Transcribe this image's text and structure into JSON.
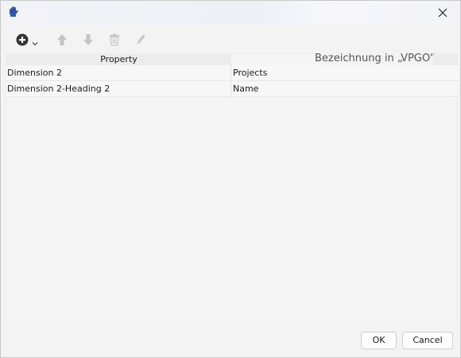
{
  "window": {
    "app_icon": "hand-icon",
    "close_icon": "close-icon"
  },
  "toolbar": {
    "buttons": [
      {
        "name": "add",
        "icon": "plus-circle-icon",
        "enabled": true
      },
      {
        "name": "move-up",
        "icon": "arrow-up-icon",
        "enabled": false
      },
      {
        "name": "move-down",
        "icon": "arrow-down-icon",
        "enabled": false
      },
      {
        "name": "delete",
        "icon": "trash-icon",
        "enabled": false
      },
      {
        "name": "edit",
        "icon": "pencil-icon",
        "enabled": false
      }
    ]
  },
  "grid": {
    "headers": {
      "property": "Property",
      "designation": "Bezeichnung in „VPGO“"
    },
    "rows": [
      {
        "property": "Dimension 2",
        "value": "Projects"
      },
      {
        "property": "Dimension 2-Heading 2",
        "value": "Name"
      }
    ]
  },
  "footer": {
    "ok_label": "OK",
    "cancel_label": "Cancel"
  },
  "colors": {
    "enabled_icon": "#3a3a3a",
    "disabled_icon": "#c4c4c4",
    "app_icon": "#2f5bb7"
  }
}
